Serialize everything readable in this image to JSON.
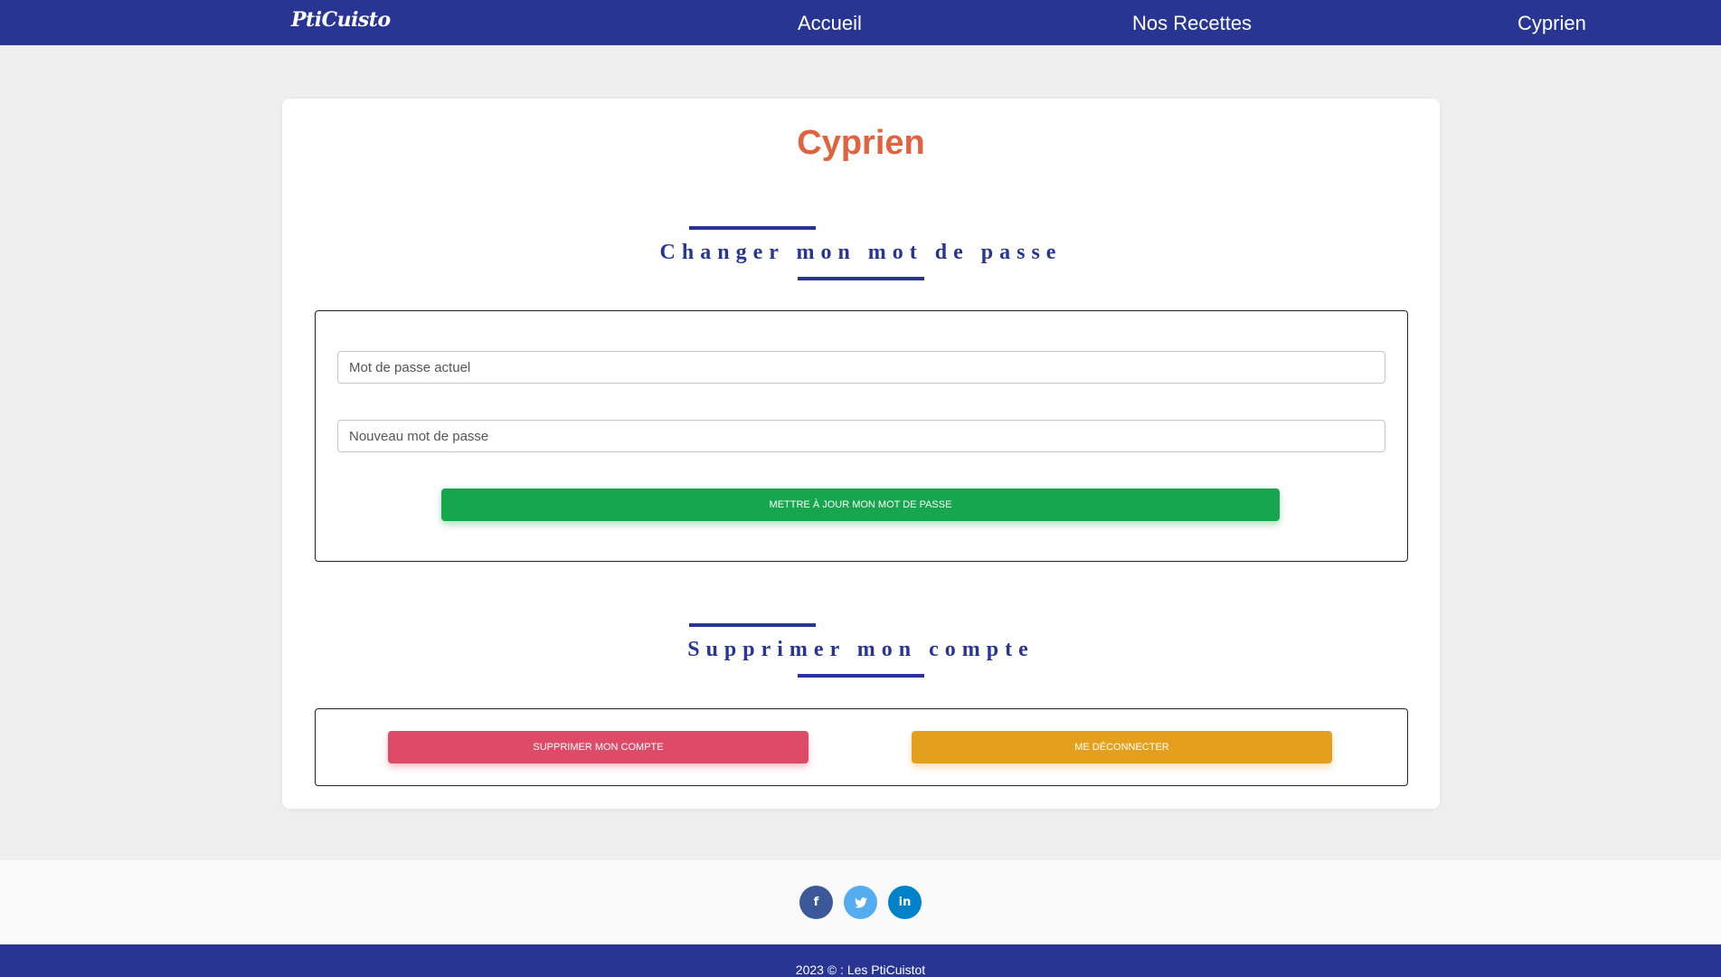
{
  "navbar": {
    "brand": "PtiCuisto",
    "links": [
      "Accueil",
      "Nos Recettes",
      "Cyprien"
    ]
  },
  "profile": {
    "username": "Cyprien"
  },
  "password_section": {
    "title": "Changer mon mot de passe",
    "current_placeholder": "Mot de passe actuel",
    "new_placeholder": "Nouveau mot de passe",
    "submit_label": "Mettre à jour mon mot de passe"
  },
  "account_section": {
    "title": "Supprimer mon compte",
    "delete_label": "Supprimer mon compte",
    "logout_label": "Me déconnecter"
  },
  "social": {
    "facebook": "f",
    "twitter": "t",
    "linkedin": "in"
  },
  "footer": {
    "copyright": "2023 © : Les PtiCuistot"
  },
  "colors": {
    "primary": "#283593",
    "accent": "#e0623f",
    "success": "#17a64e",
    "danger": "#de4b69",
    "warning": "#e4a01d"
  },
  "icons": [
    "facebook-icon",
    "twitter-icon",
    "linkedin-icon"
  ]
}
